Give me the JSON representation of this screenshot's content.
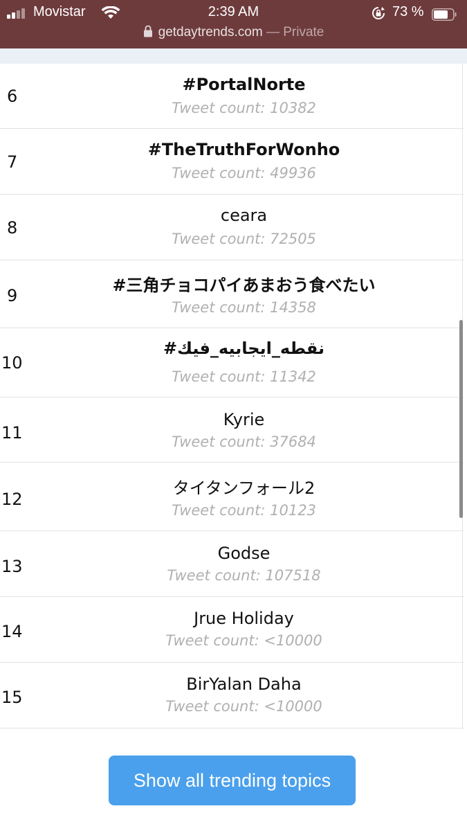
{
  "status": {
    "carrier": "Movistar",
    "time": "2:39 AM",
    "battery": "73 %"
  },
  "browser": {
    "host": "getdaytrends.com",
    "mode": "— Private"
  },
  "trends": [
    {
      "rank": "6",
      "topic": "#PortalNorte",
      "count": "Tweet count: 10382"
    },
    {
      "rank": "7",
      "topic": "#TheTruthForWonho",
      "count": "Tweet count: 49936"
    },
    {
      "rank": "8",
      "topic": "ceara",
      "count": "Tweet count: 72505"
    },
    {
      "rank": "9",
      "topic": "#三角チョコパイあまおう食べたい",
      "count": "Tweet count: 14358"
    },
    {
      "rank": "10",
      "topic": "#نقطه_ايجابيه_فيك",
      "count": "Tweet count: 11342"
    },
    {
      "rank": "11",
      "topic": "Kyrie",
      "count": "Tweet count: 37684"
    },
    {
      "rank": "12",
      "topic": "タイタンフォール2",
      "count": "Tweet count: 10123"
    },
    {
      "rank": "13",
      "topic": "Godse",
      "count": "Tweet count: 107518"
    },
    {
      "rank": "14",
      "topic": "Jrue Holiday",
      "count": "Tweet count: <10000"
    },
    {
      "rank": "15",
      "topic": "BirYalan Daha",
      "count": "Tweet count: <10000"
    }
  ],
  "show_all_label": "Show all trending topics",
  "colors": {
    "status_bg": "#6e3b3d",
    "button_bg": "#4aa0ec",
    "count_text": "#b0b0b0"
  }
}
